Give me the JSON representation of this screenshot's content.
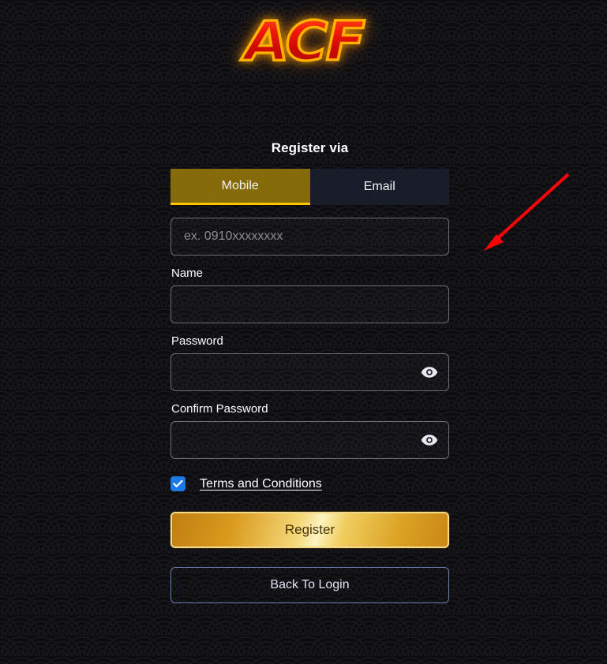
{
  "brand": {
    "logo_text": "ACF",
    "logo_fill_top": "#ff4b16",
    "logo_fill_bottom": "#b00804",
    "logo_outline": "#ffb300"
  },
  "form": {
    "section_title": "Register via",
    "tabs": [
      {
        "label": "Mobile",
        "active": true,
        "name": "tab-mobile"
      },
      {
        "label": "Email",
        "active": false,
        "name": "tab-email"
      }
    ],
    "mobile_field": {
      "value": "",
      "placeholder": "ex. 0910xxxxxxxx"
    },
    "name_field": {
      "label": "Name",
      "value": "",
      "placeholder": ""
    },
    "password_field": {
      "label": "Password",
      "value": "",
      "placeholder": "",
      "toggle_icon": "eye-icon"
    },
    "confirm_password_field": {
      "label": "Confirm Password",
      "value": "",
      "placeholder": "",
      "toggle_icon": "eye-icon"
    },
    "terms": {
      "checked": true,
      "link_label": "Terms and Conditions",
      "checkbox_color": "#1a7ae8",
      "check_icon": "check-icon"
    },
    "submit_button": {
      "label": "Register",
      "accent": "#f4d879"
    },
    "secondary_button": {
      "label": "Back To Login",
      "accent": "#6e7fae"
    }
  },
  "annotation": {
    "arrow_color": "#fa0505",
    "arrow_from": "718,221",
    "arrow_to": "613,316"
  },
  "theme": {
    "background": "#0d0d10",
    "pattern_color": "#17171b",
    "tab_active_bg": "#96780a",
    "tab_active_underline": "#ffc400",
    "tab_inactive_bg": "#1b1f2e",
    "input_border": "#6e6e72",
    "placeholder_color": "#8b8b93"
  }
}
